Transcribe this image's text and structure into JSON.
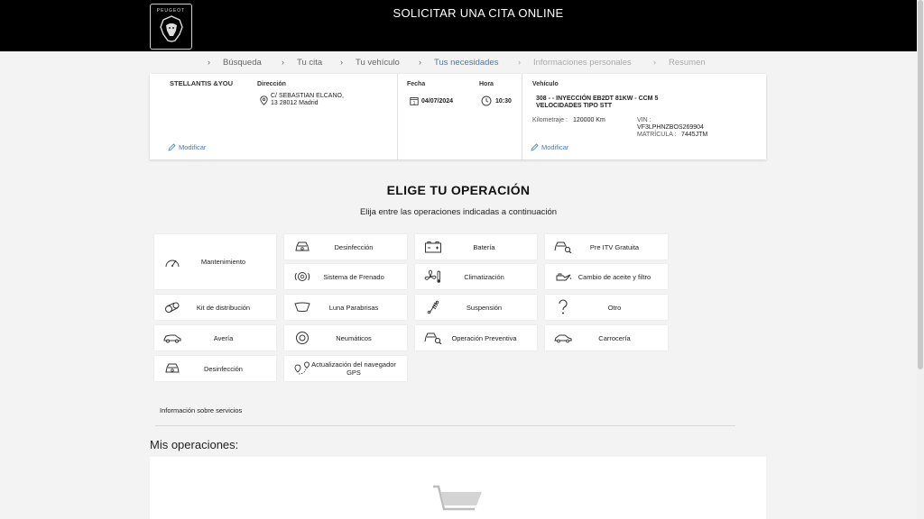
{
  "header": {
    "title": "SOLICITAR UNA CITA ONLINE",
    "logo_text": "PEUGEOT"
  },
  "stepper": [
    {
      "label": "Búsqueda",
      "state": "done"
    },
    {
      "label": "Tu cita",
      "state": "done"
    },
    {
      "label": "Tu vehículo",
      "state": "done"
    },
    {
      "label": "Tus necesidades",
      "state": "active"
    },
    {
      "label": "Informaciones personales",
      "state": "future"
    },
    {
      "label": "Resumen",
      "state": "future"
    }
  ],
  "summary": {
    "dealer": "STELLANTIS &YOU",
    "address_label": "Dirección",
    "address_line1": "C/ SEBASTIAN ELCANO,",
    "address_line2": "13 28012 Madrid",
    "date_label": "Fecha",
    "date_value": "04/07/2024",
    "time_label": "Hora",
    "time_value": "10:30",
    "vehicle_label": "Vehículo",
    "vehicle_line1": "308 - - INYECCIÓN EB2DT 81KW - CCM 5",
    "vehicle_line2": "VELOCIDADES TIPO STT",
    "mileage_label": "Kilometraje :",
    "mileage_value": "120000 Km",
    "vin_label": "VIN :",
    "vin_value": "VF3LPHNZBOS269904",
    "plate_label": "MATRÍCULA :",
    "plate_value": "7445JTM",
    "modify_label": "Modificar"
  },
  "operations": {
    "title": "ELIGE TU OPERACIÓN",
    "subtitle": "Elija entre las operaciones indicadas a continuación",
    "tiles": [
      {
        "label": "Mantenimiento",
        "icon": "gauge-icon"
      },
      {
        "label": "Desinfección",
        "icon": "car-front-icon"
      },
      {
        "label": "Batería",
        "icon": "battery-icon"
      },
      {
        "label": "Pre ITV Gratuita",
        "icon": "car-search-icon"
      },
      {
        "label": "Sistema de Frenado",
        "icon": "brake-icon"
      },
      {
        "label": "Climatización",
        "icon": "fan-icon"
      },
      {
        "label": "Cambio de aceite y filtro",
        "icon": "oil-can-icon"
      },
      {
        "label": "Kit de distribución",
        "icon": "timing-belt-icon"
      },
      {
        "label": "Luna Parabrisas",
        "icon": "windshield-icon"
      },
      {
        "label": "Suspensión",
        "icon": "shock-absorber-icon"
      },
      {
        "label": "Otro",
        "icon": "question-icon"
      },
      {
        "label": "Avería",
        "icon": "car-side-icon"
      },
      {
        "label": "Neumáticos",
        "icon": "tire-icon"
      },
      {
        "label": "Operación Preventiva",
        "icon": "car-search-icon"
      },
      {
        "label": "Carrocería",
        "icon": "car-body-icon"
      },
      {
        "label": "Desinfección",
        "icon": "car-front-icon"
      },
      {
        "label": "Actualización del navegador GPS",
        "icon": "gps-icon"
      }
    ],
    "info_link": "Información sobre servicios"
  },
  "my_operations": {
    "title": "Mis operaciones:"
  }
}
